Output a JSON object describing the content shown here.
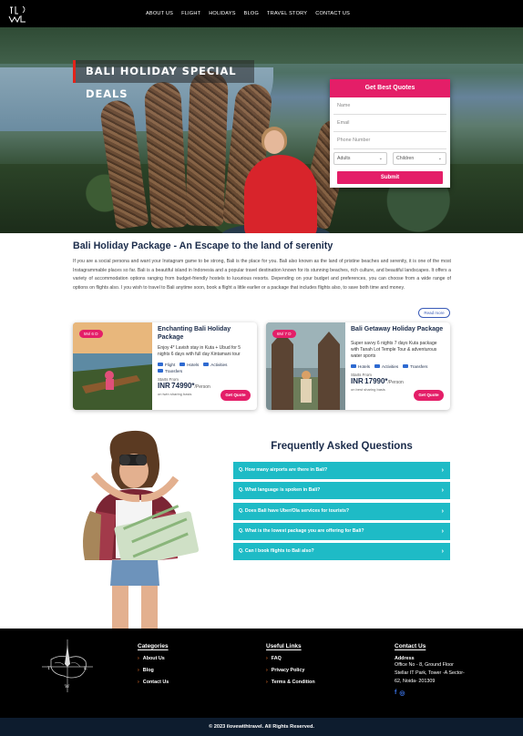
{
  "nav": {
    "logo_text": "ILW",
    "links": [
      "ABOUT US",
      "FLIGHT",
      "HOLIDAYS",
      "BLOG",
      "TRAVEL STORY",
      "CONTACT US"
    ]
  },
  "hero": {
    "title": "BALI HOLIDAY SPECIAL DEALS"
  },
  "quote_form": {
    "heading": "Get Best Quotes",
    "name_placeholder": "Name",
    "email_placeholder": "Email",
    "phone_placeholder": "Phone Number",
    "adults_value": "Adults",
    "children_value": "Children",
    "submit_label": "Submit"
  },
  "intro": {
    "title": "Bali Holiday Package - An Escape to the land of serenity",
    "text": "If you are a social persona and want your Instagram game to be strong, Bali is the place for you. Bali also known as the land of pristine beaches and serenity, it is one of the most Instagrammable places so far. Bali is a beautiful island in Indonesia and a popular travel destination known for its stunning beaches, rich culture, and beautiful landscapes. It offers a variety of accommodation options ranging from budget-friendly hostels to luxurious resorts. Depending on your budget and preferences, you can choose from a wide range of options on flights also. I you wish to travel to Bali anytime soon, book a flight a little earlier or a package that includes flights also, to save both time and money.",
    "read_more_label": "Read more"
  },
  "packages": [
    {
      "badge": "5N/ 6 D",
      "title": "Enchanting Bali Holiday Package",
      "description": "Enjoy 4* Lavish stay in Kuta + Ubud for 5 nights 6 days with full day Kintamani tour",
      "tags": [
        "Flight",
        "Hotels",
        "Activities",
        "Transfers"
      ],
      "starts_from": "Starts From",
      "currency": "INR",
      "price": "74990*",
      "per": "/Person",
      "basis": "on twin sharing basis",
      "button": "Get Quote"
    },
    {
      "badge": "6N/ 7 D",
      "title": "Bali Getaway Holiday Package",
      "description": "Super savvy 6 nights 7 days Kuta package with Tanah Lot Temple Tour & adventurous water sports",
      "tags": [
        "Hotels",
        "Activities",
        "Transfers"
      ],
      "starts_from": "Starts From",
      "currency": "INR",
      "price": "17990*",
      "per": "/Person",
      "basis": "on best sharing basis",
      "button": "Get Quote"
    }
  ],
  "faq": {
    "title": "Frequently Asked Questions",
    "items": [
      "Q. How many airports are there in Bali?",
      "Q. What language is spoken in Bali?",
      "Q. Does Bali have Uber/Ola services for tourists?",
      "Q. What is the lowest package you are offering for Bali?",
      "Q. Can I book flights to Bali also?"
    ]
  },
  "footer": {
    "logo_letters": [
      "T",
      "L",
      "W"
    ],
    "categories_title": "Categories",
    "categories": [
      "About Us",
      "Blog",
      "Contact Us"
    ],
    "useful_title": "Useful Links",
    "useful": [
      "FAQ",
      "Privacy Policy",
      "Terms & Condition"
    ],
    "contact_title": "Contact Us",
    "address_label": "Address",
    "address": "Office No - 8, Ground Floor Stellar IT Park, Tower -A Sector- 62, Noida- 201309",
    "social": [
      "f",
      "◎"
    ],
    "copyright": "© 2023 ilovewithtravel. All Rights Reserved."
  },
  "colors": {
    "accent_pink": "#e41e68",
    "faq_teal": "#1ebbc6",
    "navy_text": "#1a2b4a",
    "footer_arrow": "#e9712a"
  }
}
